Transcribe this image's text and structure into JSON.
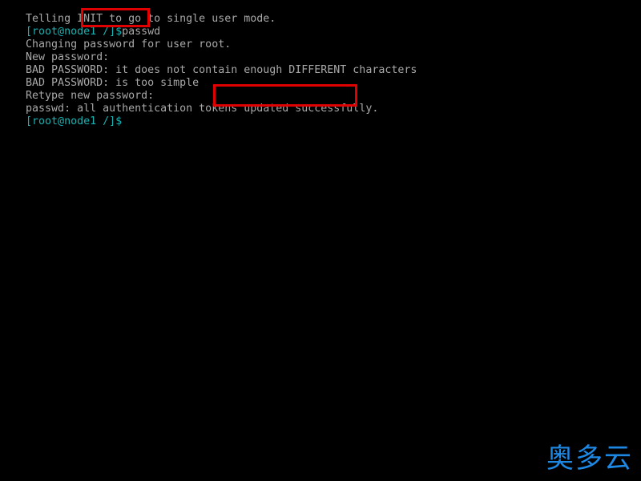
{
  "colors": {
    "background": "#000000",
    "text": "#a8a8a8",
    "prompt": "#18b2b2",
    "highlight_box": "#e00000",
    "watermark": "#1e88e5"
  },
  "terminal": {
    "lines": [
      {
        "text": "Telling INIT to go to single user mode."
      },
      {
        "prompt": "[root@node1 /]$",
        "command": "passwd"
      },
      {
        "text": "Changing password for user root."
      },
      {
        "text": "New password:"
      },
      {
        "text": "BAD PASSWORD: it does not contain enough DIFFERENT characters"
      },
      {
        "text": "BAD PASSWORD: is too simple"
      },
      {
        "text": "Retype new password:"
      },
      {
        "text_before": "passwd: all authentication tokens ",
        "text_highlight": "updated successfully."
      },
      {
        "prompt": "[root@node1 /]$",
        "command": ""
      }
    ]
  },
  "watermark": {
    "text": "奥多云"
  }
}
